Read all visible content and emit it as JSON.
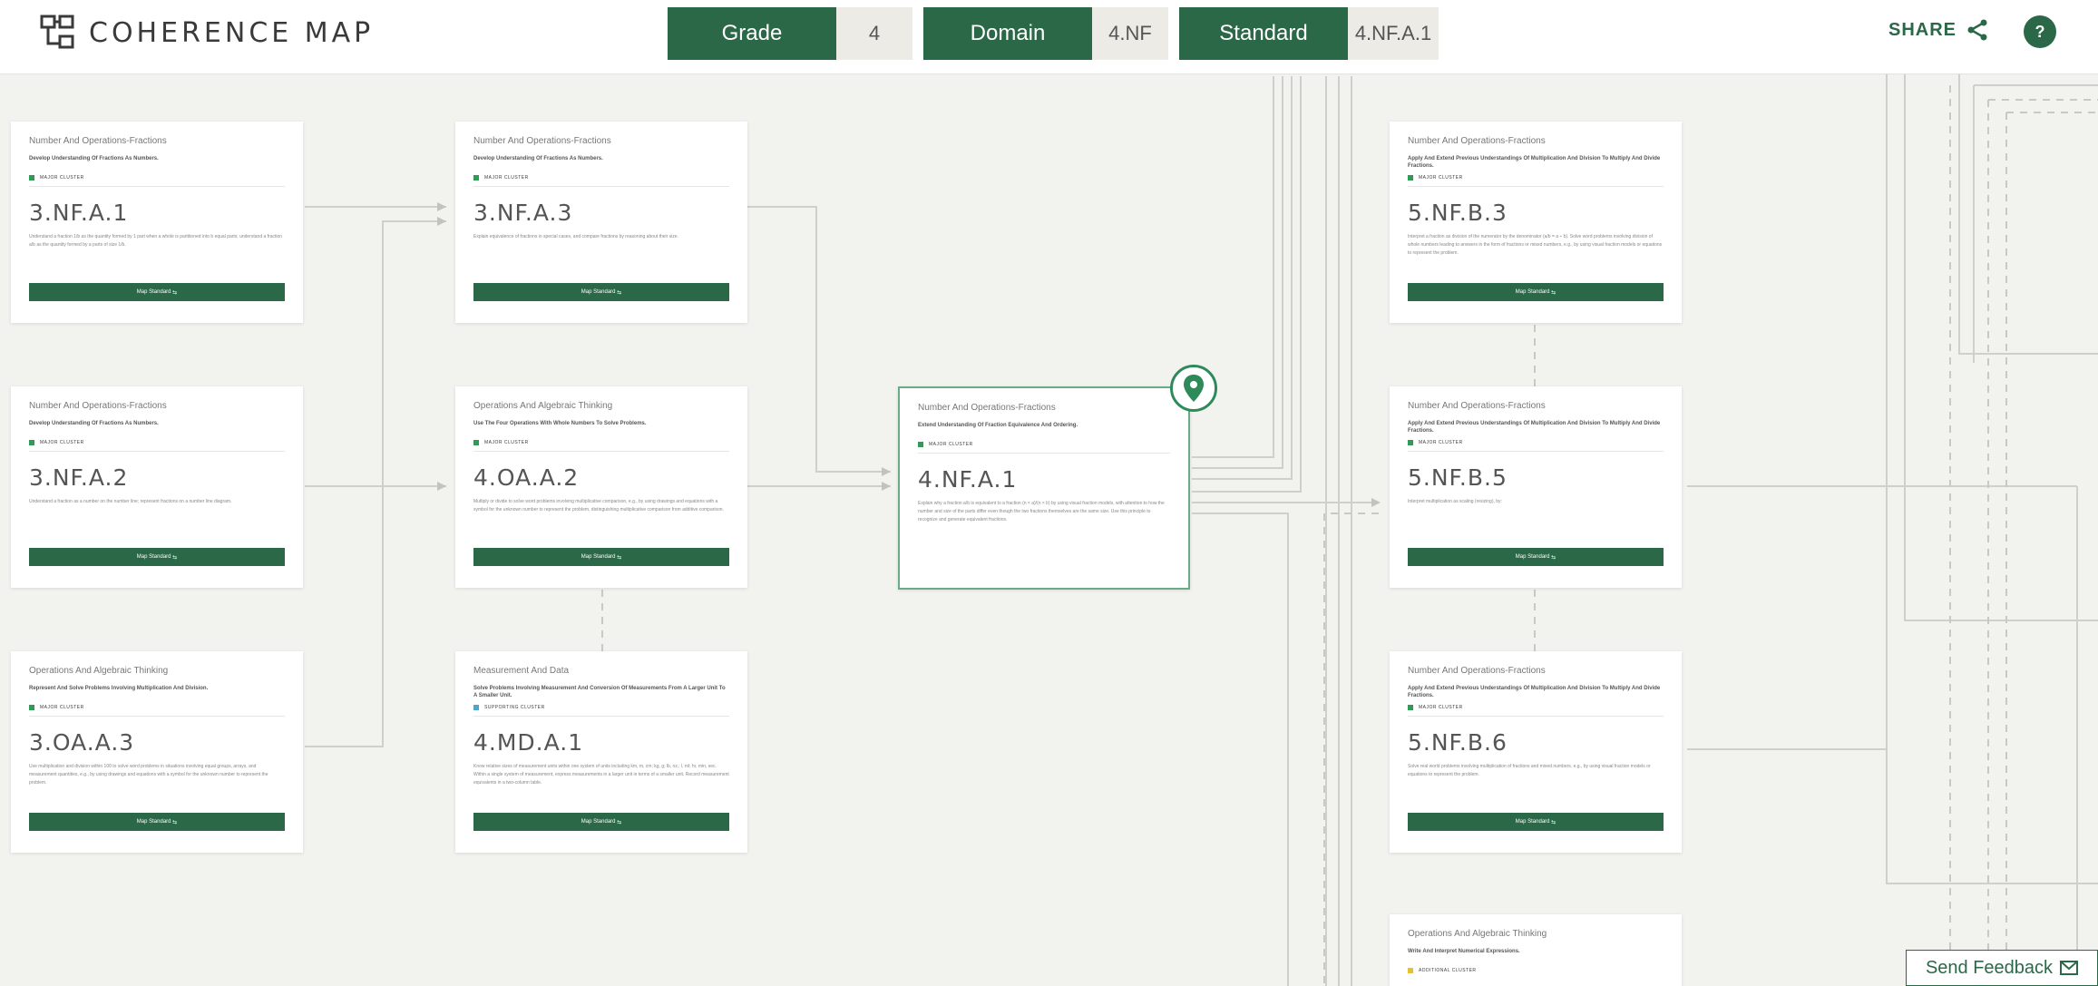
{
  "header": {
    "logo_text": "COHERENCE MAP",
    "filters": {
      "grade_label": "Grade",
      "grade_value": "4",
      "domain_label": "Domain",
      "domain_value": "4.NF",
      "standard_label": "Standard",
      "standard_value": "4.NF.A.1"
    },
    "share_label": "SHARE",
    "help_label": "?"
  },
  "colors": {
    "brand": "#2a6848",
    "major_cluster": "#2f9b57",
    "supporting_cluster": "#4fa6c8",
    "additional_cluster": "#e2c233",
    "background": "#f2f2ef"
  },
  "cards": [
    {
      "domain": "Number And Operations-Fractions",
      "cluster": "Develop Understanding Of Fractions As Numbers.",
      "tag": "MAJOR CLUSTER",
      "code": "3.NF.A.1",
      "desc": "Understand a fraction 1/b as the quantity formed by 1 part when a whole is partitioned into b equal parts; understand a fraction a/b as the quantity formed by a parts of size 1/b.",
      "button": "Map Standard"
    },
    {
      "domain": "Number And Operations-Fractions",
      "cluster": "Develop Understanding Of Fractions As Numbers.",
      "tag": "MAJOR CLUSTER",
      "code": "3.NF.A.3",
      "desc": "Explain equivalence of fractions in special cases, and compare fractions by reasoning about their size.",
      "button": "Map Standard"
    },
    {
      "domain": "Number And Operations-Fractions",
      "cluster": "Develop Understanding Of Fractions As Numbers.",
      "tag": "MAJOR CLUSTER",
      "code": "3.NF.A.2",
      "desc": "Understand a fraction as a number on the number line; represent fractions on a number line diagram.",
      "button": "Map Standard"
    },
    {
      "domain": "Operations And Algebraic Thinking",
      "cluster": "Use The Four Operations With Whole Numbers To Solve Problems.",
      "tag": "MAJOR CLUSTER",
      "code": "4.OA.A.2",
      "desc": "Multiply or divide to solve word problems involving multiplicative comparison, e.g., by using drawings and equations with a symbol for the unknown number to represent the problem, distinguishing multiplicative comparison from additive comparison.",
      "button": "Map Standard"
    },
    {
      "domain": "Operations And Algebraic Thinking",
      "cluster": "Represent And Solve Problems Involving Multiplication And Division.",
      "tag": "MAJOR CLUSTER",
      "code": "3.OA.A.3",
      "desc": "Use multiplication and division within 100 to solve word problems in situations involving equal groups, arrays, and measurement quantities, e.g., by using drawings and equations with a symbol for the unknown number to represent the problem.",
      "button": "Map Standard"
    },
    {
      "domain": "Measurement And Data",
      "cluster": "Solve Problems Involving Measurement And Conversion Of Measurements From A Larger Unit To A Smaller Unit.",
      "tag": "SUPPORTING CLUSTER",
      "code": "4.MD.A.1",
      "desc": "Know relative sizes of measurement units within one system of units including km, m, cm; kg, g; lb, oz.; l, ml; hr, min, sec. Within a single system of measurement, express measurements in a larger unit in terms of a smaller unit. Record measurement equivalents in a two-column table.",
      "button": "Map Standard"
    },
    {
      "domain": "Number And Operations-Fractions",
      "cluster": "Extend Understanding Of Fraction Equivalence And Ordering.",
      "tag": "MAJOR CLUSTER",
      "code": "4.NF.A.1",
      "desc": "Explain why a fraction a/b is equivalent to a fraction (n × a)/(n × b) by using visual fraction models, with attention to how the number and size of the parts differ even though the two fractions themselves are the same size. Use this principle to recognize and generate equivalent fractions.",
      "button": ""
    },
    {
      "domain": "Number And Operations-Fractions",
      "cluster": "Apply And Extend Previous Understandings Of Multiplication And Division To Multiply And Divide Fractions.",
      "tag": "MAJOR CLUSTER",
      "code": "5.NF.B.3",
      "desc": "Interpret a fraction as division of the numerator by the denominator (a/b = a ÷ b). Solve word problems involving division of whole numbers leading to answers in the form of fractions or mixed numbers, e.g., by using visual fraction models or equations to represent the problem.",
      "button": "Map Standard"
    },
    {
      "domain": "Number And Operations-Fractions",
      "cluster": "Apply And Extend Previous Understandings Of Multiplication And Division To Multiply And Divide Fractions.",
      "tag": "MAJOR CLUSTER",
      "code": "5.NF.B.5",
      "desc": "Interpret multiplication as scaling (resizing), by:",
      "button": "Map Standard"
    },
    {
      "domain": "Number And Operations-Fractions",
      "cluster": "Apply And Extend Previous Understandings Of Multiplication And Division To Multiply And Divide Fractions.",
      "tag": "MAJOR CLUSTER",
      "code": "5.NF.B.6",
      "desc": "Solve real world problems involving multiplication of fractions and mixed numbers, e.g., by using visual fraction models or equations to represent the problem.",
      "button": "Map Standard"
    },
    {
      "domain": "Operations And Algebraic Thinking",
      "cluster": "Write And Interpret Numerical Expressions.",
      "tag": "ADDITIONAL CLUSTER",
      "code": "",
      "desc": "",
      "button": ""
    }
  ],
  "feedback": {
    "label": "Send Feedback",
    "icon": "mail-icon"
  }
}
